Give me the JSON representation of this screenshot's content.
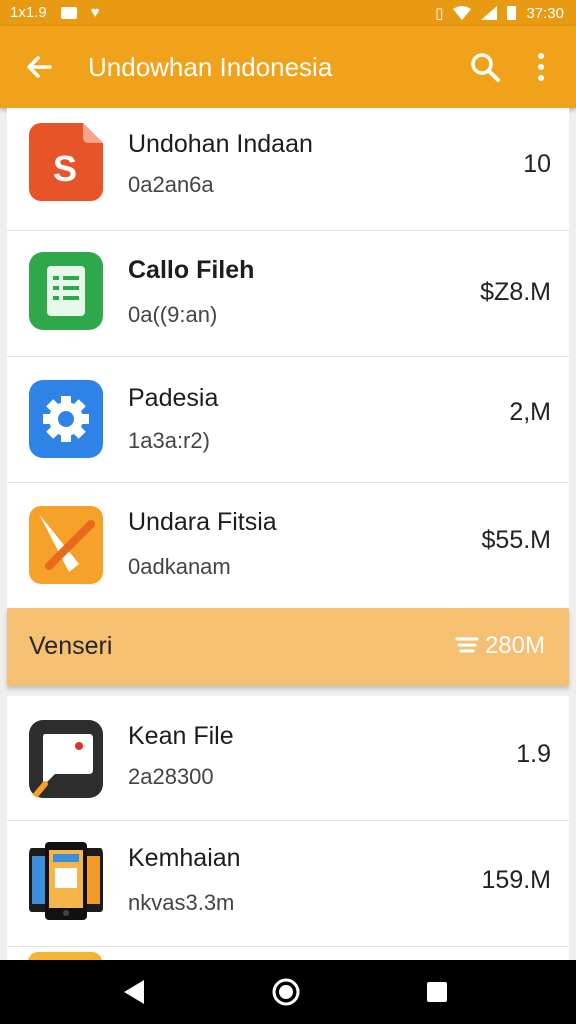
{
  "status_bar": {
    "left_text": "1x1.9",
    "time": "37:30"
  },
  "app_bar": {
    "title": "Undowhan Indonesia"
  },
  "list": [
    {
      "name": "Undohan Indaan",
      "sub": "0a2an6a",
      "value": "10",
      "icon": "slides-icon",
      "color": "#e8542a"
    },
    {
      "name": "Callo Fileh",
      "sub": "0a((9:an)",
      "value": "$Z8.M",
      "icon": "sheets-icon",
      "color": "#2ea84a"
    },
    {
      "name": "Padesia",
      "sub": "1a3a:r2)",
      "value": "2,M",
      "icon": "settings-icon",
      "color": "#2f83e6"
    },
    {
      "name": "Undara Fitsia",
      "sub": "0adkanam",
      "value": "$55.M",
      "icon": "tools-icon",
      "color": "#f6a12a"
    }
  ],
  "section": {
    "label": "Venseri",
    "total": "280M"
  },
  "list2": [
    {
      "name": "Kean File",
      "sub": "2a28300",
      "value": "1.9",
      "icon": "chat-icon",
      "color": "#2d2d2d"
    },
    {
      "name": "Kemhaian",
      "sub": "nkvas3.3m",
      "value": "159.M",
      "icon": "phones-icon",
      "color": "#555555"
    }
  ]
}
